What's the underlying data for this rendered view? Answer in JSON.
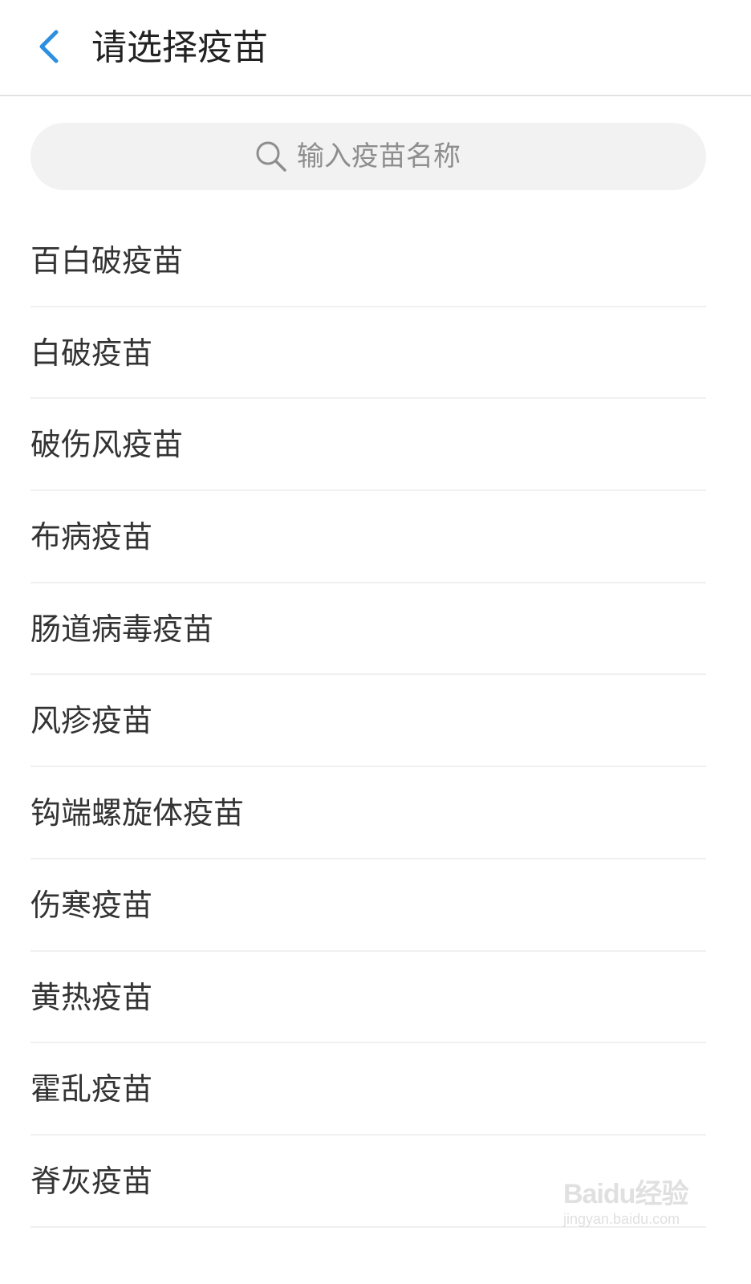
{
  "header": {
    "title": "请选择疫苗",
    "back_icon": "chevron-left-icon",
    "accent_color": "#2d8fe0"
  },
  "search": {
    "placeholder": "输入疫苗名称",
    "value": "",
    "icon": "search-icon"
  },
  "vaccines": [
    {
      "label": "百白破疫苗"
    },
    {
      "label": "白破疫苗"
    },
    {
      "label": "破伤风疫苗"
    },
    {
      "label": "布病疫苗"
    },
    {
      "label": "肠道病毒疫苗"
    },
    {
      "label": "风疹疫苗"
    },
    {
      "label": "钩端螺旋体疫苗"
    },
    {
      "label": "伤寒疫苗"
    },
    {
      "label": "黄热疫苗"
    },
    {
      "label": "霍乱疫苗"
    },
    {
      "label": "脊灰疫苗"
    }
  ],
  "watermark": {
    "logo": "Baidu经验",
    "url": "jingyan.baidu.com"
  }
}
